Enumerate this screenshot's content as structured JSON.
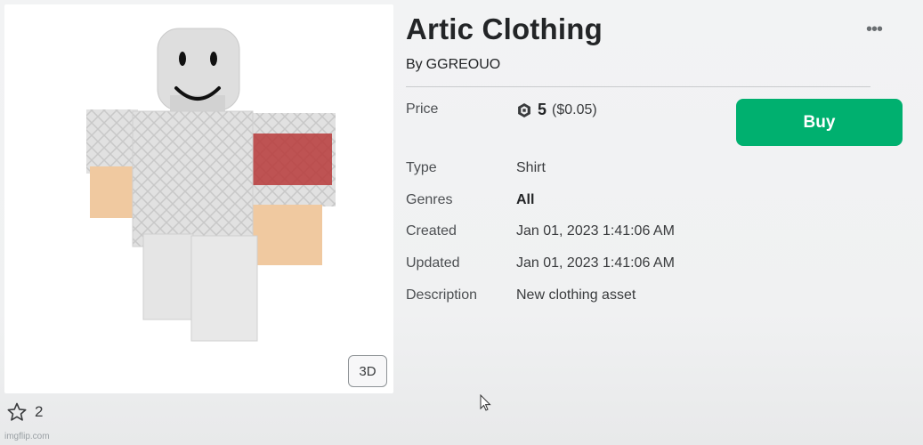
{
  "item": {
    "title": "Artic Clothing",
    "by_label": "By",
    "creator": "GGREOUO",
    "more_icon": "•••"
  },
  "details": {
    "price_label": "Price",
    "price_robux": "5",
    "price_usd": "($0.05)",
    "type_label": "Type",
    "type_value": "Shirt",
    "genres_label": "Genres",
    "genres_value": "All",
    "created_label": "Created",
    "created_value": "Jan 01, 2023 1:41:06 AM",
    "updated_label": "Updated",
    "updated_value": "Jan 01, 2023 1:41:06 AM",
    "description_label": "Description",
    "description_value": "New clothing asset"
  },
  "actions": {
    "buy_label": "Buy",
    "view_3d_label": "3D"
  },
  "favorites": {
    "count": "2"
  },
  "watermark": "imgflip.com",
  "colors": {
    "buy_button": "#00b06f",
    "title_text": "#232527"
  }
}
